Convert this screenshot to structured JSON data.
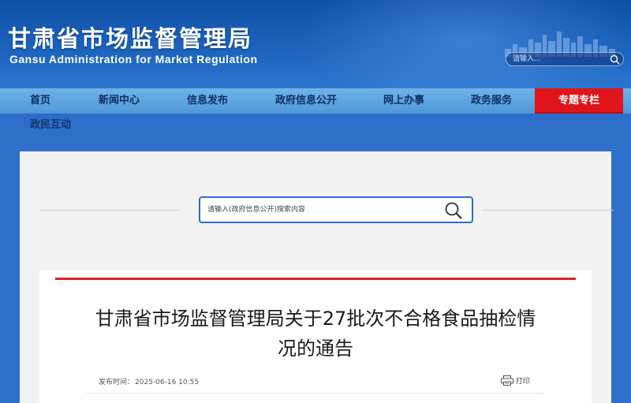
{
  "header": {
    "title_cn": "甘肃省市场监督管理局",
    "title_en": "Gansu Administration for Market Regulation",
    "search_placeholder": "请输入...",
    "search_icon": "search-icon",
    "colors": {
      "header_blue": "#1c63bd",
      "nav_blue": "#5ea5e0",
      "accent_red": "#e0141b"
    }
  },
  "nav": {
    "items": [
      {
        "label": "首页"
      },
      {
        "label": "新闻中心"
      },
      {
        "label": "信息发布"
      },
      {
        "label": "政府信息公开"
      },
      {
        "label": "网上办事"
      },
      {
        "label": "政务服务"
      },
      {
        "label": "专题专栏",
        "active": true
      },
      {
        "label": "政民互动"
      }
    ]
  },
  "search": {
    "placeholder": "请输入(政府信息公开)搜索内容",
    "icon": "magnifier-icon"
  },
  "article": {
    "title": "甘肃省市场监督管理局关于27批次不合格食品抽检情况的通告",
    "publish_label": "发布时间：",
    "publish_time": "2025-06-16 10:55",
    "print_label": "打印",
    "print_icon": "printer-icon"
  }
}
